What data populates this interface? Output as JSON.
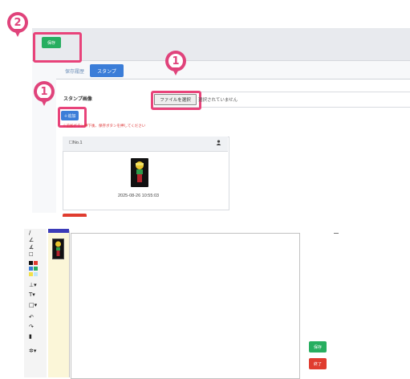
{
  "top": {
    "save_button": "保存",
    "tabs": [
      {
        "label": "保存履歴"
      },
      {
        "label": "スタンプ"
      }
    ],
    "form": {
      "stamp_label": "スタンプ画像",
      "file_button": "ファイルを選択",
      "file_status": "選択されていません",
      "add_button": "＋追加",
      "note": "※追加ボタン押下後、保存ボタンを押してください"
    },
    "card": {
      "title": "☐No.1",
      "person_icon": "person-icon",
      "date": "2025-08-26 10:55:03"
    }
  },
  "markers": [
    {
      "label": "2"
    },
    {
      "label": "1"
    },
    {
      "label": "1"
    }
  ],
  "editor": {
    "tools": [
      "pen-icon",
      "pen-icon",
      "pen-bold-icon",
      "eraser-icon",
      "color-icon",
      "color-icon",
      "color-icon",
      "stamp-tool-icon",
      "text-tool-icon",
      "shape-tool-icon",
      "undo-icon",
      "redo-icon",
      "trash-icon",
      "settings-icon"
    ],
    "save_button": "保存",
    "close_button": "終了"
  },
  "colors": {
    "highlight": "#e8437a",
    "green": "#27ae60",
    "red": "#e03c2f",
    "blue": "#3b7dd8"
  }
}
